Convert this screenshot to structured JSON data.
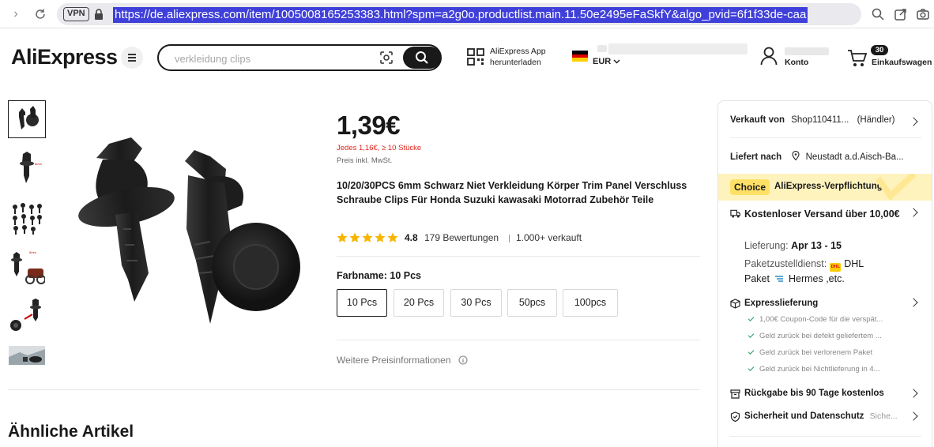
{
  "browser": {
    "vpn_label": "VPN",
    "url": "https://de.aliexpress.com/item/1005008165253383.html?spm=a2g0o.productlist.main.11.50e2495eFaSkfY&algo_pvid=6f1f33de-caa"
  },
  "header": {
    "logo": "AliExpress",
    "search_placeholder": "verkleidung clips",
    "app_download_line1": "AliExpress App",
    "app_download_line2": "herunterladen",
    "currency": "EUR",
    "account_label": "Konto",
    "cart_count": "30",
    "cart_label": "Einkaufswagen"
  },
  "product": {
    "price": "1,39€",
    "bulk_price": "Jedes 1,16€, ≥ 10 Stücke",
    "tax_note": "Preis inkl. MwSt.",
    "title": "10/20/30PCS 6mm Schwarz Niet Verkleidung Körper Trim Panel Verschluss Schraube Clips Für Honda Suzuki kawasaki Motorrad Zubehör Teile",
    "rating": "4.8",
    "reviews": "179 Bewertungen",
    "sold": "1.000+ verkauft",
    "color_label": "Farbname: 10 Pcs",
    "variants": [
      "10 Pcs",
      "20 Pcs",
      "30 Pcs",
      "50pcs",
      "100pcs"
    ],
    "more_price_info": "Weitere Preisinformationen"
  },
  "similar_title": "Ähnliche Artikel",
  "panel": {
    "sold_by_label": "Verkauft von",
    "seller": "Shop110411...",
    "seller_type": "(Händler)",
    "ship_to_label": "Liefert nach",
    "ship_to": "Neustadt a.d.Aisch-Ba...",
    "choice_badge": "Choice",
    "choice_text": "AliExpress-Verpflichtung",
    "free_shipping": "Kostenloser Versand über 10,00€",
    "delivery_label": "Lieferung:",
    "delivery_date": "Apr 13 - 15",
    "courier_label": "Paketzustelldienst:",
    "courier_dhl": "DHL",
    "courier_line2_prefix": "Paket",
    "courier_hermes": "Hermes ,etc.",
    "express_title": "Expresslieferung",
    "express_items": [
      "1,00€ Coupon-Code für die verspät...",
      "Geld zurück bei defekt geliefertem ...",
      "Geld zurück bei verlorenem Paket",
      "Geld zurück bei Nichtlieferung in 4..."
    ],
    "returns": "Rückgabe bis 90 Tage kostenlos",
    "security": "Sicherheit und Datenschutz",
    "security_more": "Siche..."
  },
  "colors": {
    "accent_red": "#e1251b",
    "choice_yellow": "#ffe066",
    "dark": "#191919"
  }
}
